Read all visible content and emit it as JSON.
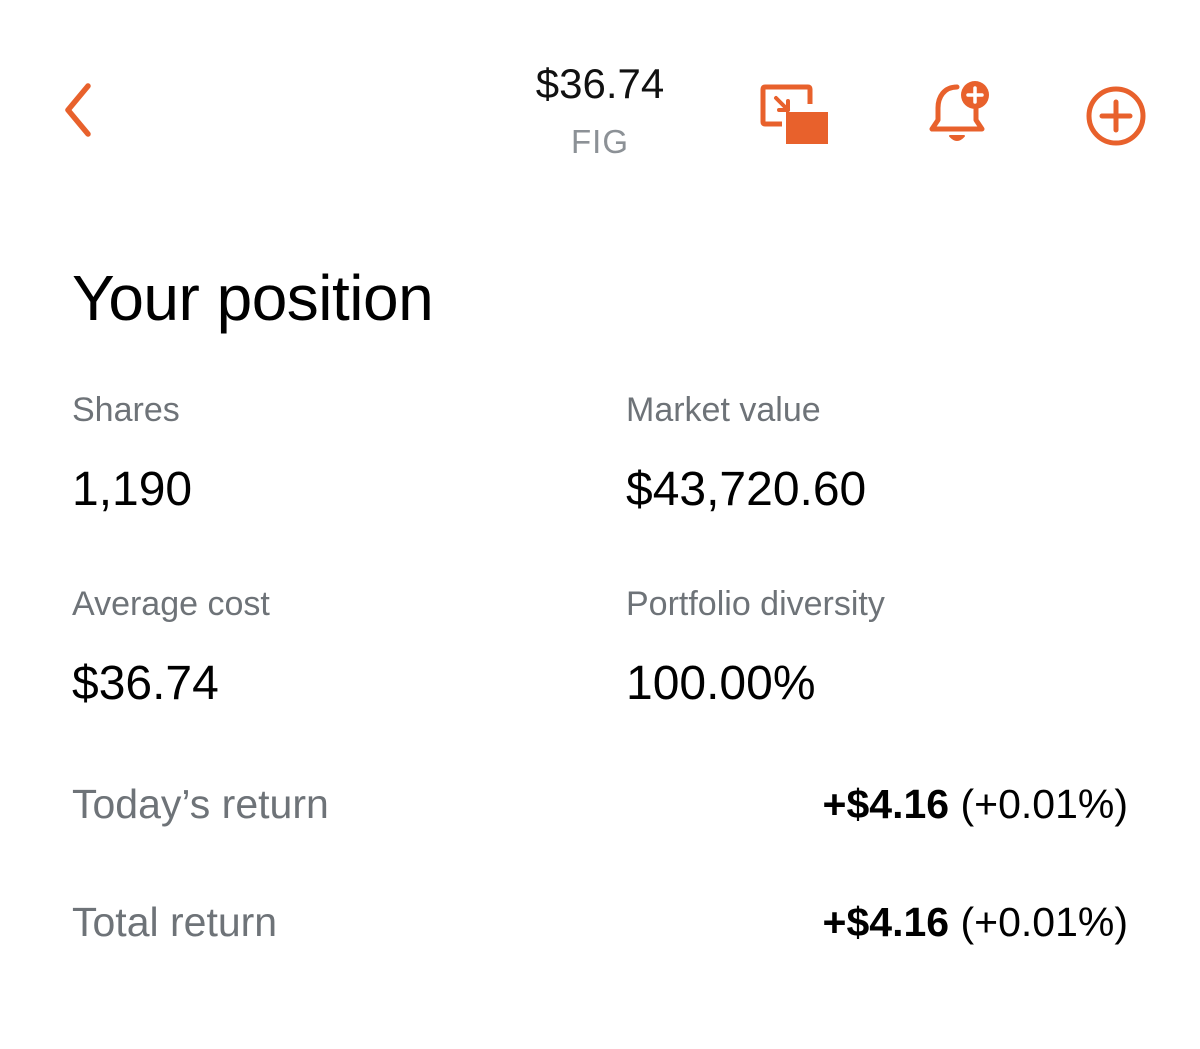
{
  "header": {
    "price": "$36.74",
    "ticker": "FIG",
    "back_icon": "chevron-left-icon",
    "pip_icon": "picture-in-picture-icon",
    "alert_icon": "bell-add-icon",
    "add_icon": "plus-circle-icon"
  },
  "position": {
    "title": "Your position",
    "shares": {
      "label": "Shares",
      "value": "1,190"
    },
    "market_value": {
      "label": "Market value",
      "value": "$43,720.60"
    },
    "average_cost": {
      "label": "Average cost",
      "value": "$36.74"
    },
    "portfolio_diversity": {
      "label": "Portfolio diversity",
      "value": "100.00%"
    },
    "todays_return": {
      "label": "Today’s return",
      "amount": "+$4.16",
      "percent": "(+0.01%)"
    },
    "total_return": {
      "label": "Total return",
      "amount": "+$4.16",
      "percent": "(+0.01%)"
    }
  },
  "colors": {
    "accent": "#e8612c",
    "label_gray": "#6e7378",
    "ticker_gray": "#8c9196",
    "text": "#000000",
    "background": "#ffffff"
  }
}
